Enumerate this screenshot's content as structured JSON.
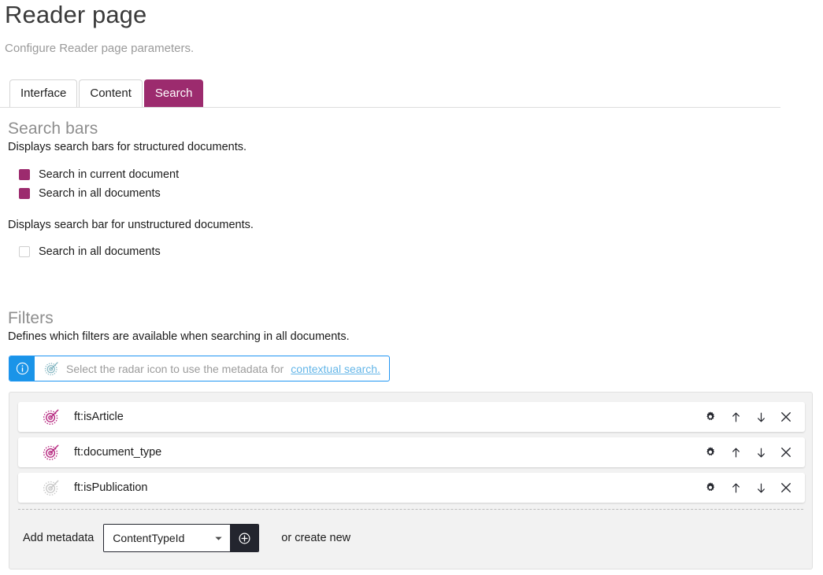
{
  "header": {
    "title": "Reader page",
    "subtitle": "Configure Reader page parameters."
  },
  "tabs": [
    {
      "label": "Interface",
      "active": false
    },
    {
      "label": "Content",
      "active": false
    },
    {
      "label": "Search",
      "active": true
    }
  ],
  "search_bars": {
    "heading": "Search bars",
    "structured_desc": "Displays search bars for structured documents.",
    "structured_options": [
      {
        "label": "Search in current document",
        "checked": true
      },
      {
        "label": "Search in all documents",
        "checked": true
      }
    ],
    "unstructured_desc": "Displays search bar for unstructured documents.",
    "unstructured_options": [
      {
        "label": "Search in all documents",
        "checked": false
      }
    ]
  },
  "filters": {
    "heading": "Filters",
    "description": "Defines which filters are available when searching in all documents.",
    "banner": {
      "icon": "info-icon",
      "radar_icon": "radar-icon",
      "text": "Select the radar icon to use the metadata for",
      "link": "contextual search."
    },
    "rows": [
      {
        "label": "ft:isArticle",
        "radar_active": true
      },
      {
        "label": "ft:document_type",
        "radar_active": true
      },
      {
        "label": "ft:isPublication",
        "radar_active": false
      }
    ],
    "row_actions": [
      {
        "name": "settings-icon",
        "title": "gear"
      },
      {
        "name": "move-up-icon",
        "title": "up arrow"
      },
      {
        "name": "move-down-icon",
        "title": "down arrow"
      },
      {
        "name": "remove-icon",
        "title": "close"
      }
    ],
    "add_metadata": {
      "label": "Add metadata",
      "select_value": "ContentTypeId",
      "add_button_icon": "add-circle-icon",
      "create_new_label": "or create new"
    }
  },
  "colors": {
    "accent_magenta": "#9c2b6e",
    "info_blue": "#1a94e8",
    "link_blue": "#64b6e8",
    "dark_button": "#23252e",
    "panel_gray": "#f2f2f2",
    "radar_inactive": "#c8c8c8"
  }
}
